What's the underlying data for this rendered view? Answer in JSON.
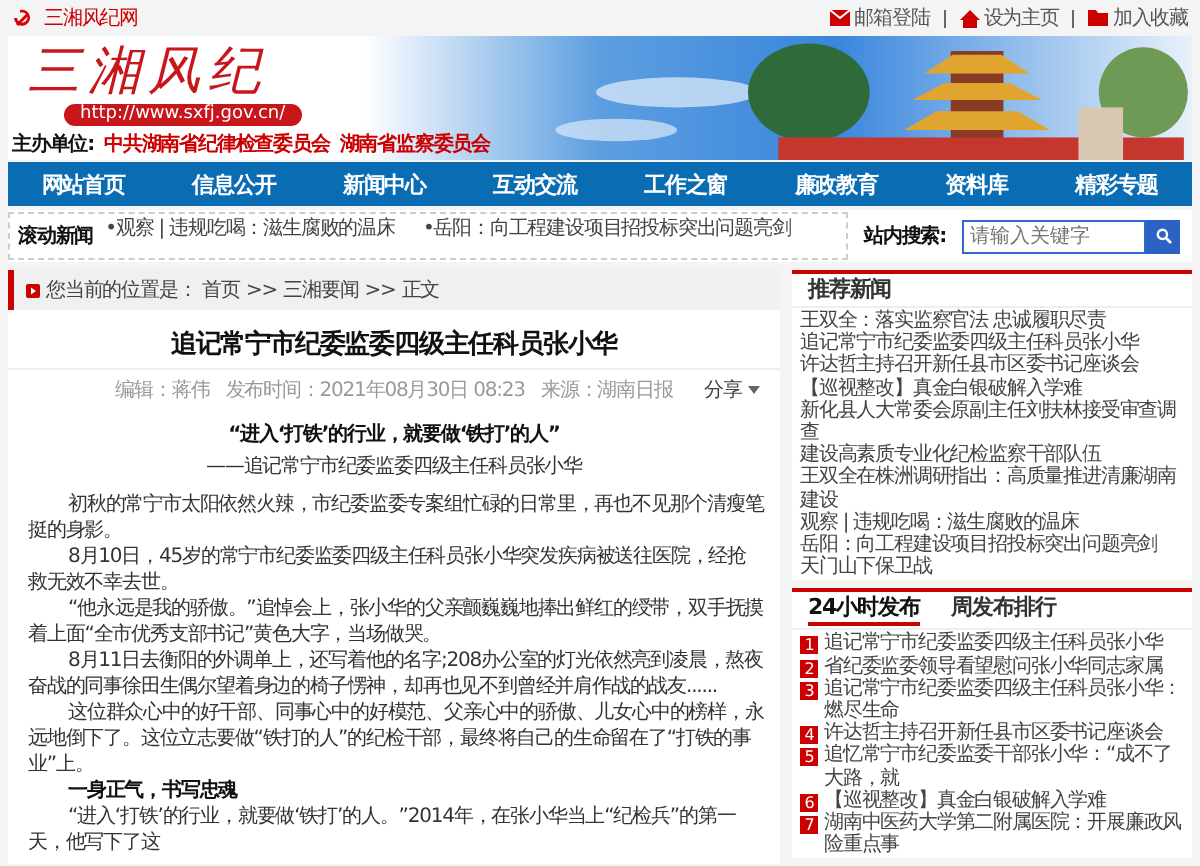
{
  "top_bar": {
    "site_name": "三湘风纪网",
    "links": [
      "邮箱登陆",
      "设为主页",
      "加入收藏"
    ]
  },
  "banner": {
    "logo": "三湘风纪",
    "url": "http://www.sxfj.gov.cn/",
    "sponsor_label": "主办单位:",
    "sponsors": [
      "中共湖南省纪律检查委员会",
      "湖南省监察委员会"
    ]
  },
  "nav": [
    "网站首页",
    "信息公开",
    "新闻中心",
    "互动交流",
    "工作之窗",
    "廉政教育",
    "资料库",
    "精彩专题"
  ],
  "ticker": {
    "label": "滚动新闻",
    "items": [
      "•观察 | 违规吃喝：滋生腐败的温床",
      "•岳阳：向工程建设项目招投标突出问题亮剑"
    ]
  },
  "search": {
    "label": "站内搜索:",
    "placeholder": "请输入关键字"
  },
  "breadcrumb": {
    "prefix": "您当前的位置是：",
    "separator": ">>",
    "items": [
      "首页",
      "三湘要闻",
      "正文"
    ]
  },
  "article": {
    "title": "追记常宁市纪委监委四级主任科员张小华",
    "meta": [
      "编辑：蒋伟",
      "发布时间：2021年08月30日 08:23",
      "来源：湖南日报"
    ],
    "share": "分享",
    "quote": "“进入‘打铁’的行业，就要做‘铁打’的人”",
    "byline": "——追记常宁市纪委监委四级主任科员张小华",
    "paragraphs": [
      {
        "kind": "text",
        "text": "初秋的常宁市太阳依然火辣，市纪委监委专案组忙碌的日常里，再也不见那个清瘦笔挺的身影。"
      },
      {
        "kind": "text",
        "text": "8月10日，45岁的常宁市纪委监委四级主任科员张小华突发疾病被送往医院，经抢救无效不幸去世。"
      },
      {
        "kind": "text",
        "text": "“他永远是我的骄傲。”追悼会上，张小华的父亲颤巍巍地捧出鲜红的绶带，双手抚摸着上面“全市优秀支部书记”黄色大字，当场做哭。"
      },
      {
        "kind": "text",
        "text": "8月11日去衡阳的外调单上，还写着他的名字;208办公室的灯光依然亮到凌晨，熬夜奋战的同事徐田生偶尔望着身边的椅子愣神，却再也见不到曾经并肩作战的战友......"
      },
      {
        "kind": "text",
        "text": "这位群众心中的好干部、同事心中的好模范、父亲心中的骄傲、儿女心中的榜样，永远地倒下了。这位立志要做“铁打的人”的纪检干部，最终将自己的生命留在了“打铁的事业”上。"
      },
      {
        "kind": "heading",
        "text": "一身正气，书写忠魂"
      },
      {
        "kind": "text",
        "text": "“进入‘打铁’的行业，就要做‘铁打’的人。”2014年，在张小华当上“纪检兵”的第一天，他写下了这"
      }
    ]
  },
  "recommended": {
    "title": "推荐新闻",
    "items": [
      "王双全：落实监察官法 忠诚履职尽责",
      "追记常宁市纪委监委四级主任科员张小华",
      "许达哲主持召开新任县市区委书记座谈会",
      "【巡视整改】真金白银破解入学难",
      "新化县人大常委会原副主任刘扶林接受审查调查",
      "建设高素质专业化纪检监察干部队伍",
      "王双全在株洲调研指出：高质量推进清廉湖南建设",
      "观察 | 违规吃喝：滋生腐败的温床",
      "岳阳：向工程建设项目招投标突出问题亮剑",
      "天门山下保卫战"
    ]
  },
  "ranking": {
    "tabs": [
      {
        "label": "24小时发布",
        "selected": true
      },
      {
        "label": "周发布排行",
        "selected": false
      }
    ],
    "items": [
      {
        "rank": "1",
        "title": "追记常宁市纪委监委四级主任科员张小华"
      },
      {
        "rank": "2",
        "title": "省纪委监委领导看望慰问张小华同志家属"
      },
      {
        "rank": "3",
        "title": "追记常宁市纪委监委四级主任科员张小华：燃尽生命"
      },
      {
        "rank": "4",
        "title": "许达哲主持召开新任县市区委书记座谈会"
      },
      {
        "rank": "5",
        "title": "追忆常宁市纪委监委干部张小华：“成不了大路，就"
      },
      {
        "rank": "6",
        "title": "【巡视整改】真金白银破解入学难"
      },
      {
        "rank": "7",
        "title": "湖南中医药大学第二附属医院：开展廉政风险重点事"
      }
    ]
  }
}
